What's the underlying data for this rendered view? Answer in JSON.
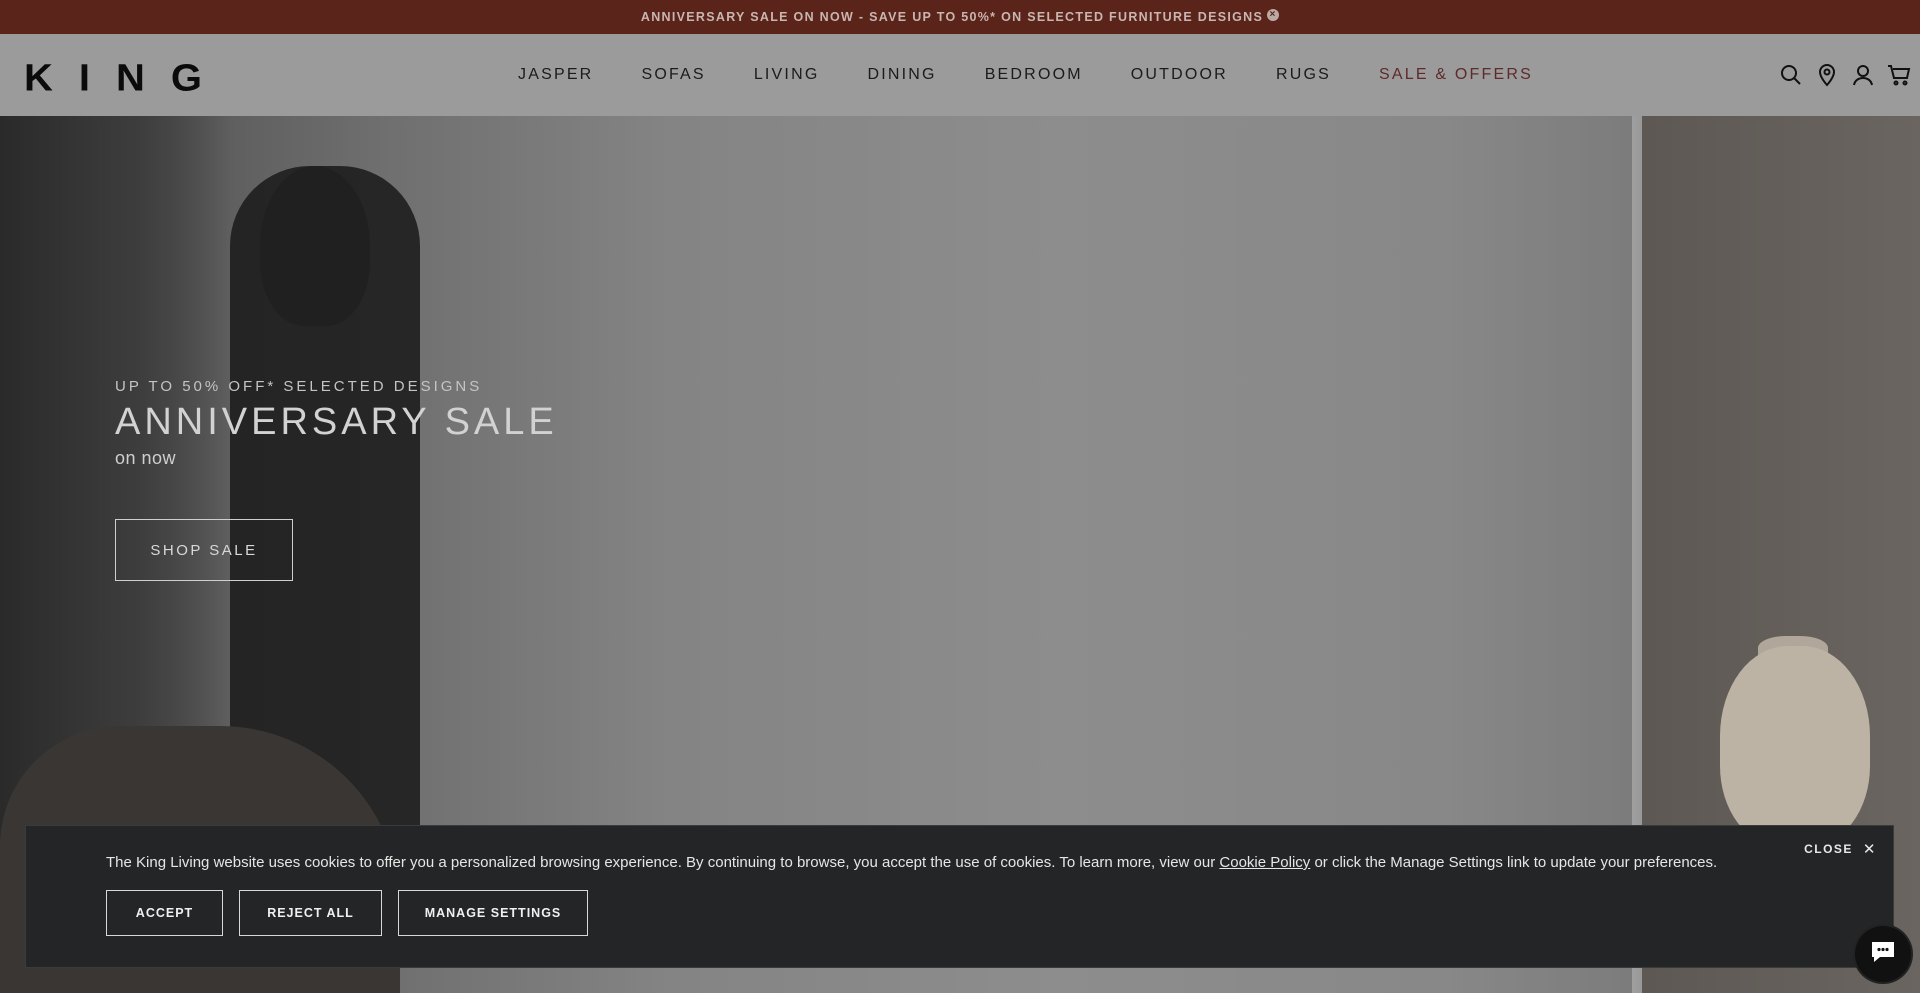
{
  "announcement": {
    "text": "ANNIVERSARY SALE ON NOW - SAVE UP TO 50%* ON SELECTED FURNITURE DESIGNS",
    "close_icon": "×"
  },
  "header": {
    "logo": "KING",
    "nav": [
      {
        "label": "JASPER"
      },
      {
        "label": "SOFAS"
      },
      {
        "label": "LIVING"
      },
      {
        "label": "DINING"
      },
      {
        "label": "BEDROOM"
      },
      {
        "label": "OUTDOOR"
      },
      {
        "label": "RUGS"
      },
      {
        "label": "SALE & OFFERS"
      }
    ],
    "icons": [
      "search-icon",
      "location-pin-icon",
      "account-icon",
      "cart-icon"
    ]
  },
  "hero": {
    "eyebrow": "UP TO 50% OFF* SELECTED DESIGNS",
    "title": "ANNIVERSARY SALE",
    "subtitle": "on now",
    "button_label": "SHOP SALE"
  },
  "cookie": {
    "text_before": "The King Living website uses cookies to offer you a personalized browsing experience. By continuing to browse, you accept the use of cookies. To learn more, view our ",
    "link_label": "Cookie Policy",
    "text_after": " or click the Manage Settings link to update your preferences.",
    "close_label": "CLOSE",
    "accept_label": "ACCEPT",
    "reject_label": "REJECT ALL",
    "manage_label": "MANAGE SETTINGS"
  },
  "colors": {
    "announcement_bg": "#5a241a",
    "sale_nav": "#5e2a2a",
    "cookie_bg": "#242526"
  }
}
